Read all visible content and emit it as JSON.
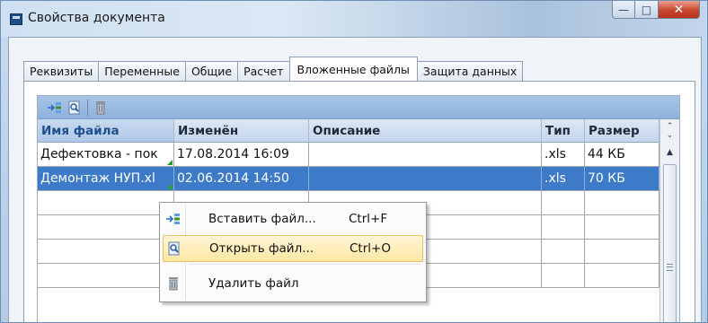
{
  "window": {
    "title": "Свойства документа",
    "controls": {
      "minimize": "—",
      "maximize": "□",
      "close": "✕"
    }
  },
  "tabs": [
    {
      "label": "Реквизиты",
      "active": false
    },
    {
      "label": "Переменные",
      "active": false
    },
    {
      "label": "Общие",
      "active": false
    },
    {
      "label": "Расчет",
      "active": false
    },
    {
      "label": "Вложенные файлы",
      "active": true
    },
    {
      "label": "Защита данных",
      "active": false
    }
  ],
  "toolbar": {
    "insert_icon": "insert-file-icon",
    "open_icon": "open-file-icon",
    "delete_icon": "trash-icon"
  },
  "grid": {
    "columns": [
      {
        "label": "Имя файла"
      },
      {
        "label": "Изменён"
      },
      {
        "label": "Описание"
      },
      {
        "label": "Тип"
      },
      {
        "label": "Размер"
      }
    ],
    "rows": [
      {
        "name": "Дефектовка - пок",
        "modified": "17.08.2014 16:09",
        "description": "",
        "type": ".xls",
        "size": "44 КБ",
        "selected": false
      },
      {
        "name": "Демонтаж НУП.xl",
        "modified": "02.06.2014 14:50",
        "description": "",
        "type": ".xls",
        "size": "70 КБ",
        "selected": true
      },
      {
        "name": "",
        "modified": "",
        "description": "",
        "type": "",
        "size": "",
        "selected": false
      },
      {
        "name": "",
        "modified": "",
        "description": "",
        "type": "",
        "size": "",
        "selected": false
      },
      {
        "name": "",
        "modified": "",
        "description": "",
        "type": "",
        "size": "",
        "selected": false
      },
      {
        "name": "",
        "modified": "",
        "description": "",
        "type": "",
        "size": "",
        "selected": false
      }
    ]
  },
  "context_menu": {
    "items": [
      {
        "label": "Вставить файл...",
        "shortcut": "Ctrl+F",
        "icon": "insert-file-icon",
        "highlighted": false
      },
      {
        "label": "Открыть файл...",
        "shortcut": "Ctrl+O",
        "icon": "open-file-icon",
        "highlighted": true
      },
      {
        "label": "Удалить файл",
        "shortcut": "",
        "icon": "trash-icon",
        "highlighted": false
      }
    ]
  },
  "colors": {
    "selection": "#3d7bc8",
    "menu_highlight": "#ffe7a3",
    "toolbar": "#9bbbe1"
  }
}
